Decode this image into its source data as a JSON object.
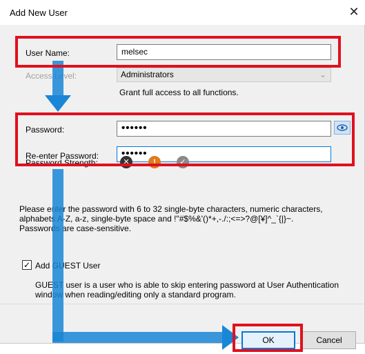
{
  "window": {
    "title": "Add New User",
    "close_glyph": "✕"
  },
  "user_name": {
    "label": "User Name:",
    "value": "melsec"
  },
  "access_level": {
    "label": "Access Level:",
    "value": "Administrators",
    "description": "Grant full access to all functions."
  },
  "password": {
    "label": "Password:",
    "value": "••••••"
  },
  "reenter_password": {
    "label": "Re-enter Password:",
    "value": "••••••"
  },
  "password_strength": {
    "label": "Password Strength:",
    "icons": [
      "x-circle-icon",
      "warning-circle-icon",
      "check-circle-icon"
    ]
  },
  "instructions": {
    "line1": "Please enter the password with 6 to 32 single-byte characters, numeric characters,",
    "line2": "alphabets A-Z, a-z, single-byte space and !\"#$%&'()*+,-./:;<=>?@[¥]^_`{|}~.",
    "line3": "Passwords are case-sensitive."
  },
  "guest": {
    "checkbox_label": "Add GUEST User",
    "checked": true,
    "description_line1": "GUEST user is a user who is able to skip entering password at User Authentication",
    "description_line2": "window when reading/editing only a standard program."
  },
  "buttons": {
    "ok": "OK",
    "cancel": "Cancel"
  },
  "colors": {
    "highlight_red": "#e0101e",
    "arrow_blue": "#1a86d6",
    "focus_blue": "#0078d7"
  }
}
